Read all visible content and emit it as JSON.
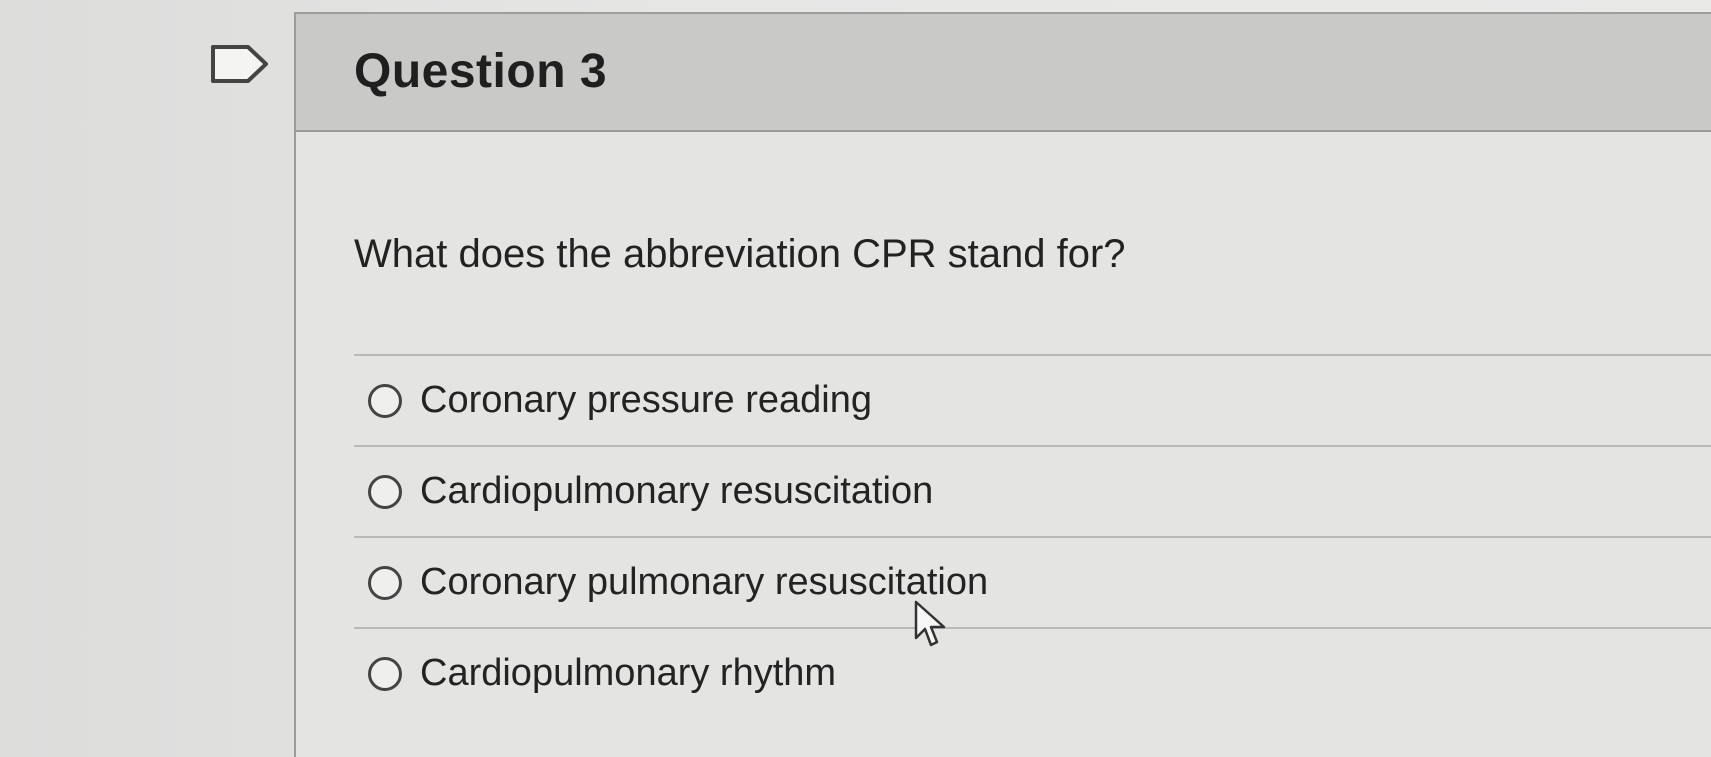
{
  "question": {
    "title": "Question 3",
    "text": "What does the abbreviation CPR stand for?",
    "answers": [
      {
        "label": "Coronary pressure reading"
      },
      {
        "label": "Cardiopulmonary resuscitation"
      },
      {
        "label": "Coronary pulmonary resuscitation"
      },
      {
        "label": "Cardiopulmonary rhythm"
      }
    ]
  },
  "icons": {
    "flag": "flag-icon",
    "cursor": "mouse-pointer-icon"
  }
}
